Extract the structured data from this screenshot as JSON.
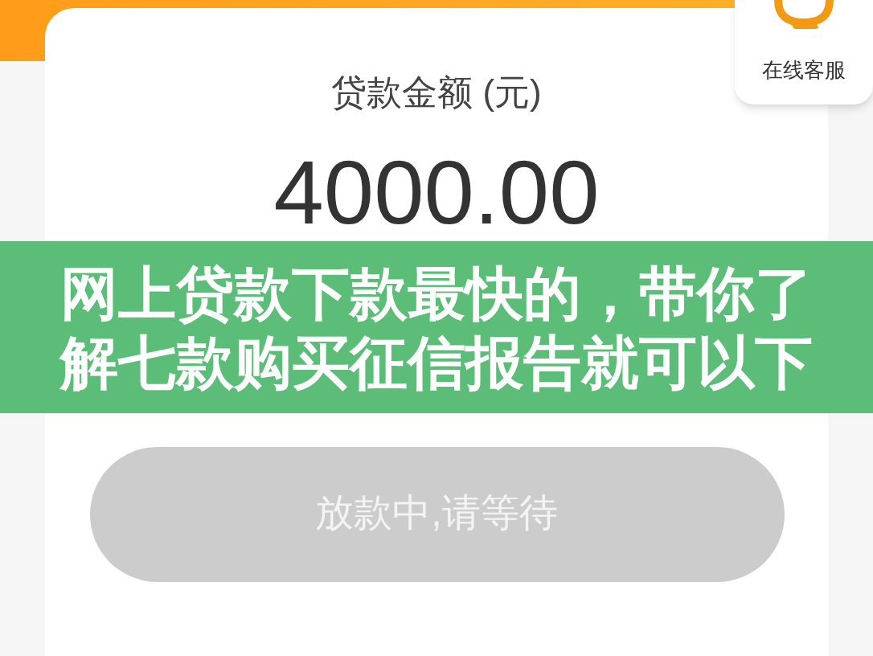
{
  "customer_service": {
    "label": "在线客服"
  },
  "loan": {
    "label": "贷款金额 (元)",
    "amount": "4000.00"
  },
  "status_button": {
    "label": "放款中,请等待",
    "disabled": true
  },
  "banner": {
    "title": "网上贷款下款最快的，带你了解七款购买征信报告就可以下"
  }
}
